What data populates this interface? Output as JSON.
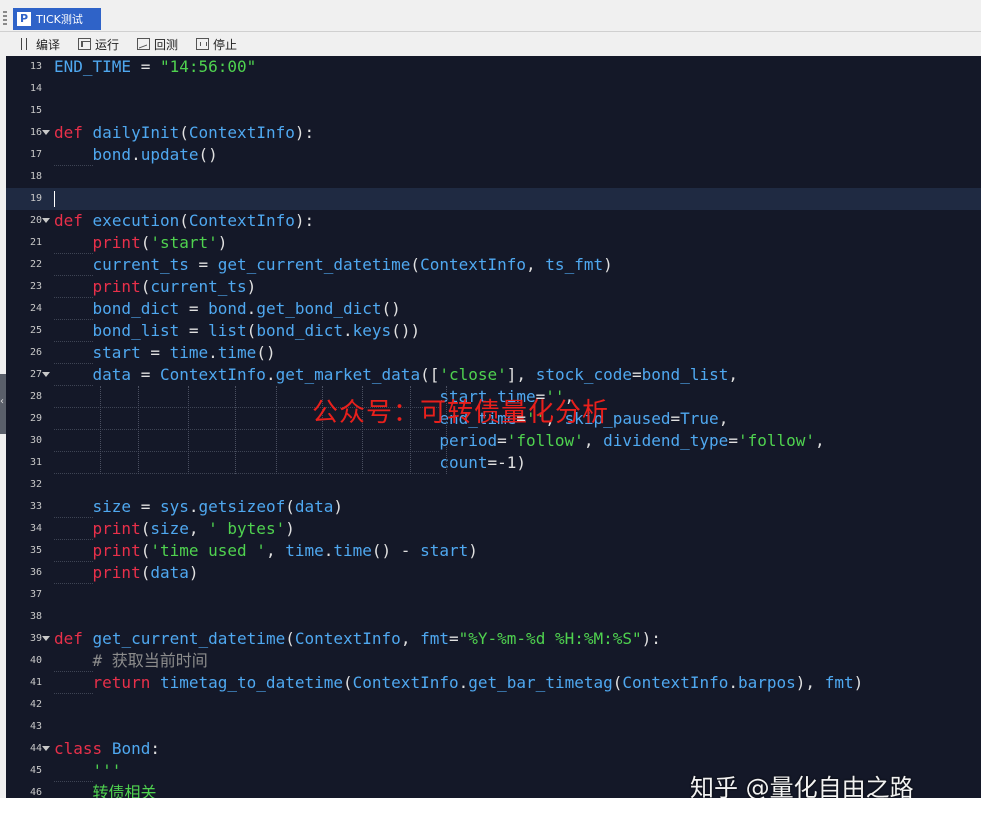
{
  "tab": {
    "icon": "P",
    "title": "TICK测试"
  },
  "toolbar": {
    "compile_label": "编译",
    "run_label": "运行",
    "backtest_label": "回测",
    "stop_label": "停止"
  },
  "editor": {
    "lines": [
      {
        "n": "13",
        "fold": false,
        "html": "<span class=\"fn\">END_TIME</span> = <span class=\"str\">\"14:56:00\"</span>"
      },
      {
        "n": "14",
        "fold": false,
        "html": ""
      },
      {
        "n": "15",
        "fold": false,
        "html": ""
      },
      {
        "n": "16",
        "fold": true,
        "html": "<span class=\"kw\">def</span> <span class=\"fn\">dailyInit</span>(<span class=\"fn\">ContextInfo</span>):"
      },
      {
        "n": "17",
        "fold": false,
        "html": "    <span class=\"fn\">bond</span>.<span class=\"fn\">update</span>()"
      },
      {
        "n": "18",
        "fold": false,
        "html": ""
      },
      {
        "n": "19",
        "fold": false,
        "html": "",
        "current": true
      },
      {
        "n": "20",
        "fold": true,
        "html": "<span class=\"kw\">def</span> <span class=\"fn\">execution</span>(<span class=\"fn\">ContextInfo</span>):"
      },
      {
        "n": "21",
        "fold": false,
        "html": "    <span class=\"kw\">print</span>(<span class=\"str\">'start'</span>)"
      },
      {
        "n": "22",
        "fold": false,
        "html": "    <span class=\"fn\">current_ts</span> = <span class=\"fn\">get_current_datetime</span>(<span class=\"fn\">ContextInfo</span>, <span class=\"fn\">ts_fmt</span>)"
      },
      {
        "n": "23",
        "fold": false,
        "html": "    <span class=\"kw\">print</span>(<span class=\"fn\">current_ts</span>)"
      },
      {
        "n": "24",
        "fold": false,
        "html": "    <span class=\"fn\">bond_dict</span> = <span class=\"fn\">bond</span>.<span class=\"fn\">get_bond_dict</span>()"
      },
      {
        "n": "25",
        "fold": false,
        "html": "    <span class=\"fn\">bond_list</span> = <span class=\"fn\">list</span>(<span class=\"fn\">bond_dict</span>.<span class=\"fn\">keys</span>())"
      },
      {
        "n": "26",
        "fold": false,
        "html": "    <span class=\"fn\">start</span> = <span class=\"fn\">time</span>.<span class=\"fn\">time</span>()"
      },
      {
        "n": "27",
        "fold": true,
        "html": "    <span class=\"fn\">data</span> = <span class=\"fn\">ContextInfo</span>.<span class=\"fn\">get_market_data</span>([<span class=\"str\">'close'</span>], <span class=\"fn\">stock_code</span>=<span class=\"fn\">bond_list</span>,"
      },
      {
        "n": "28",
        "fold": false,
        "html": "                                        <span class=\"fn\">start_time</span>=<span class=\"str\">''</span>,"
      },
      {
        "n": "29",
        "fold": false,
        "html": "                                        <span class=\"fn\">end_time</span>=<span class=\"str\">''</span>, <span class=\"fn\">skip_paused</span>=<span class=\"fn\">True</span>,"
      },
      {
        "n": "30",
        "fold": false,
        "html": "                                        <span class=\"fn\">period</span>=<span class=\"str\">'follow'</span>, <span class=\"fn\">dividend_type</span>=<span class=\"str\">'follow'</span>,"
      },
      {
        "n": "31",
        "fold": false,
        "html": "                                        <span class=\"fn\">count</span>=-1)"
      },
      {
        "n": "32",
        "fold": false,
        "html": ""
      },
      {
        "n": "33",
        "fold": false,
        "html": "    <span class=\"fn\">size</span> = <span class=\"fn\">sys</span>.<span class=\"fn\">getsizeof</span>(<span class=\"fn\">data</span>)"
      },
      {
        "n": "34",
        "fold": false,
        "html": "    <span class=\"kw\">print</span>(<span class=\"fn\">size</span>, <span class=\"str\">' bytes'</span>)"
      },
      {
        "n": "35",
        "fold": false,
        "html": "    <span class=\"kw\">print</span>(<span class=\"str\">'time used '</span>, <span class=\"fn\">time</span>.<span class=\"fn\">time</span>() - <span class=\"fn\">start</span>)"
      },
      {
        "n": "36",
        "fold": false,
        "html": "    <span class=\"kw\">print</span>(<span class=\"fn\">data</span>)"
      },
      {
        "n": "37",
        "fold": false,
        "html": ""
      },
      {
        "n": "38",
        "fold": false,
        "html": ""
      },
      {
        "n": "39",
        "fold": true,
        "html": "<span class=\"kw\">def</span> <span class=\"fn\">get_current_datetime</span>(<span class=\"fn\">ContextInfo</span>, <span class=\"fn\">fmt</span>=<span class=\"str\">\"%Y-%m-%d %H:%M:%S\"</span>):"
      },
      {
        "n": "40",
        "fold": false,
        "html": "    <span class=\"cmt\"># 获取当前时间</span>"
      },
      {
        "n": "41",
        "fold": false,
        "html": "    <span class=\"kw\">return</span> <span class=\"fn\">timetag_to_datetime</span>(<span class=\"fn\">ContextInfo</span>.<span class=\"fn\">get_bar_timetag</span>(<span class=\"fn\">ContextInfo</span>.<span class=\"fn\">barpos</span>), <span class=\"fn\">fmt</span>)"
      },
      {
        "n": "42",
        "fold": false,
        "html": ""
      },
      {
        "n": "43",
        "fold": false,
        "html": ""
      },
      {
        "n": "44",
        "fold": true,
        "html": "<span class=\"kw\">class</span> <span class=\"fn\">Bond</span>:"
      },
      {
        "n": "45",
        "fold": false,
        "html": "    <span class=\"str\">'''</span>"
      },
      {
        "n": "46",
        "fold": false,
        "html": "    <span class=\"str\">转债相关</span>"
      }
    ]
  },
  "watermark": "公众号：可转债量化分析",
  "zhihu_watermark": "知乎 @量化自由之路",
  "colors": {
    "editor_bg": "#141828",
    "keyword": "#e8304a",
    "identifier": "#4fa8f0",
    "string": "#4fd24f",
    "tab_bg": "#2f63c8"
  }
}
